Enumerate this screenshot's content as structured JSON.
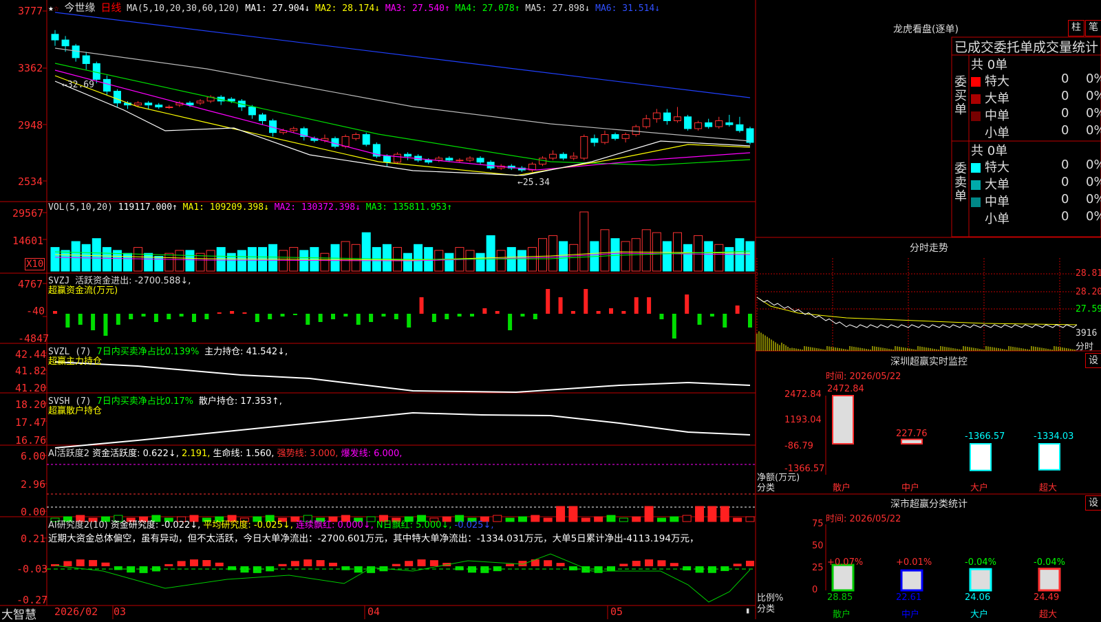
{
  "stock": {
    "name": "今世缘",
    "period": "日线",
    "ma_label": "MA(5,10,20,30,60,120)"
  },
  "header_main": {
    "ma1": "MA1: 27.904↓",
    "ma2": "MA2: 28.174↓",
    "ma3": "MA3: 27.540↑",
    "ma4": "MA4: 27.078↑",
    "ma5": "MA5: 27.898↓",
    "ma6": "MA6: 31.514↓",
    "colors": {
      "ma1": "#ffffff",
      "ma2": "#ffff00",
      "ma3": "#ff00ff",
      "ma4": "#00ff00",
      "ma5": "#c0c0c0",
      "ma6": "#0000ff"
    }
  },
  "price_axis": [
    "3777",
    "3362",
    "2948",
    "2534"
  ],
  "price_annot": {
    "high": "32.69",
    "low": "25.34"
  },
  "vol_header": {
    "label": "VOL(5,10,20)",
    "value": "119117.000↑",
    "ma1": "MA1: 109209.398↓",
    "ma2": "MA2: 130372.398↓",
    "ma3": "MA3: 135811.953↑"
  },
  "vol_axis": [
    "29567",
    "14601"
  ],
  "vol_unit": "X10",
  "svzj": {
    "label": "SVZJ",
    "line1": "活跃资金进出: -2700.588↓,",
    "line2": "超赢资金流(万元)",
    "axis": [
      "4767",
      "-40",
      "-4847"
    ]
  },
  "svzl": {
    "label": "SVZL (7)",
    "t1": "7日内买卖净占比0.139%",
    "t2": "主力持仓: 41.542↓,",
    "line2": "超赢主力持仓",
    "axis": [
      "42.44",
      "41.82",
      "41.20"
    ]
  },
  "svsh": {
    "label": "SVSH (7)",
    "t1": "7日内买卖净占比0.17%",
    "t2": "散户持仓: 17.353↑,",
    "line2": "超赢散户持仓",
    "axis": [
      "18.20",
      "17.47",
      "16.76"
    ]
  },
  "ai1": {
    "a": "AI活跃度2",
    "b": "资金活跃度: 0.622↓,",
    "c": "2.191,",
    "d": "生命线: 1.560,",
    "e": "强势线: 3.000,",
    "f": "爆发线: 6.000,",
    "axis": [
      "6.00",
      "2.96",
      "0.00"
    ]
  },
  "ai2": {
    "a": "AI研究度2(10)",
    "b": "资金研究度: -0.022↓,",
    "c": "平均研究度: -0.025↓,",
    "d": "连续飘红: 0.000↓,",
    "e": "N日飘红: 5.000↓,",
    "f": "-0.025↓,",
    "summary": "近期大资金总体偏空，虽有异动，但不太活跃，今日大单净流出：-2700.601万元，其中特大单净流出：-1334.031万元，大单5日累计净出-4113.194万元，",
    "axis": [
      "0.21",
      "-0.03",
      "-0.27"
    ]
  },
  "bottom": {
    "brand": "大智慧",
    "date": "2026/02",
    "m3": "03",
    "m4": "04",
    "m5": "05"
  },
  "right_top": {
    "title": "龙虎看盘(逐单)",
    "btn1": "柱",
    "btn2": "笔",
    "stat_title": "已成交委托单成交量统计",
    "buy_label": "委买单",
    "sell_label": "委卖单",
    "buy_total": "共 0单",
    "sell_total": "共 0单",
    "buy_rows": [
      {
        "name": "特大",
        "v": "0",
        "p": "0%",
        "color": "#ff0000"
      },
      {
        "name": "大单",
        "v": "0",
        "p": "0%",
        "color": "#aa0000"
      },
      {
        "name": "中单",
        "v": "0",
        "p": "0%",
        "color": "#770000"
      },
      {
        "name": "小单",
        "v": "0",
        "p": "0%",
        "color": "#000000"
      }
    ],
    "sell_rows": [
      {
        "name": "特大",
        "v": "0",
        "p": "0%",
        "color": "#00ffff"
      },
      {
        "name": "大单",
        "v": "0",
        "p": "0%",
        "color": "#00aaaa"
      },
      {
        "name": "中单",
        "v": "0",
        "p": "0%",
        "color": "#008888"
      },
      {
        "name": "小单",
        "v": "0",
        "p": "0%",
        "color": "#000000"
      }
    ]
  },
  "intraday": {
    "title": "分时走势",
    "axis": [
      "28.81",
      "28.20",
      "27.59"
    ],
    "vol": "3916",
    "unit": "分时"
  },
  "sz_monitor": {
    "title": "深圳超赢实时监控",
    "btn": "设",
    "time": "时间: 2026/05/22",
    "axis": [
      "2472.84",
      "1193.04",
      "-86.79",
      "-1366.57"
    ],
    "unit": "净额(万元)",
    "cat_label": "分类",
    "cats": [
      "散户",
      "中户",
      "大户",
      "超大"
    ],
    "values": [
      2472.84,
      227.76,
      -1366.57,
      -1334.03
    ],
    "labels": [
      "2472.84",
      "227.76",
      "-1366.57",
      "-1334.03"
    ]
  },
  "sz_class": {
    "title": "深市超赢分类统计",
    "btn": "设",
    "time": "时间: 2026/05/22",
    "axis": [
      "75",
      "50",
      "25",
      "0"
    ],
    "unit": "比例%",
    "cat_label": "分类",
    "cats": [
      "散户",
      "中户",
      "大户",
      "超大"
    ],
    "pcts": [
      "+0.07%",
      "+0.01%",
      "-0.04%",
      "-0.04%"
    ],
    "vals": [
      "28.85",
      "22.61",
      "24.06",
      "24.49"
    ],
    "values": [
      28.85,
      22.61,
      24.06,
      24.49
    ]
  },
  "chart_data": {
    "type": "line",
    "title": "今世缘 日线",
    "series": [
      {
        "name": "MA1",
        "last": 27.904
      },
      {
        "name": "MA2",
        "last": 28.174
      },
      {
        "name": "MA3",
        "last": 27.54
      },
      {
        "name": "MA4",
        "last": 27.078
      },
      {
        "name": "MA5",
        "last": 27.898
      },
      {
        "name": "MA6",
        "last": 31.514
      }
    ]
  }
}
